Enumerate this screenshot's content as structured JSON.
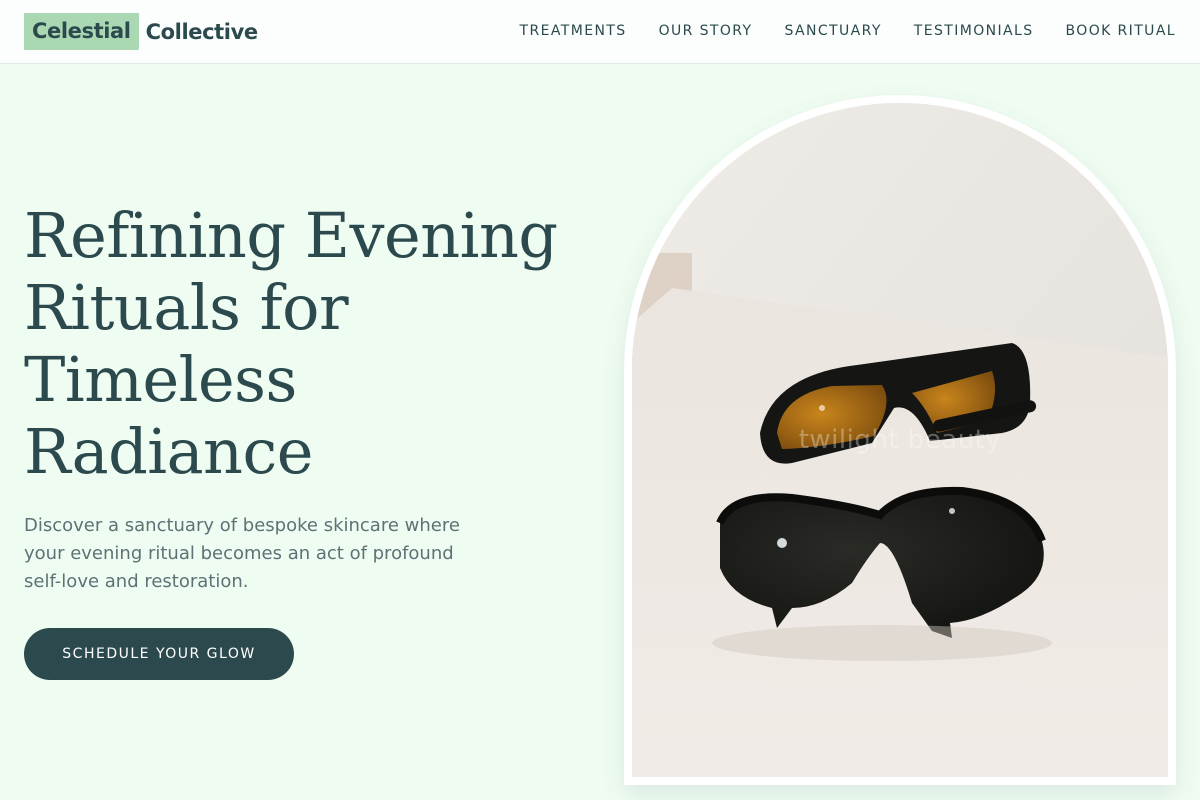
{
  "header": {
    "logo": {
      "highlight": "Celestial",
      "rest": "Collective"
    },
    "nav": [
      {
        "label": "TREATMENTS"
      },
      {
        "label": "OUR STORY"
      },
      {
        "label": "SANCTUARY"
      },
      {
        "label": "TESTIMONIALS"
      },
      {
        "label": "BOOK RITUAL"
      }
    ]
  },
  "hero": {
    "title_lines": [
      "Refining Evening",
      "Rituals for",
      "Timeless",
      "Radiance"
    ],
    "subtitle": "Discover a sanctuary of bespoke skincare where your evening ritual becomes an act of profound self-love and restoration.",
    "cta_label": "SCHEDULE YOUR GLOW",
    "image": {
      "watermark": "twilight beauty",
      "subject": "two pairs of protective sunglasses on a white surface"
    }
  },
  "colors": {
    "background": "#effcf2",
    "header_bg": "#fbfefc",
    "primary": "#2c4a4e",
    "logo_highlight": "#a9d8b3",
    "body_text": "#5d7275",
    "frame": "#ffffff"
  }
}
